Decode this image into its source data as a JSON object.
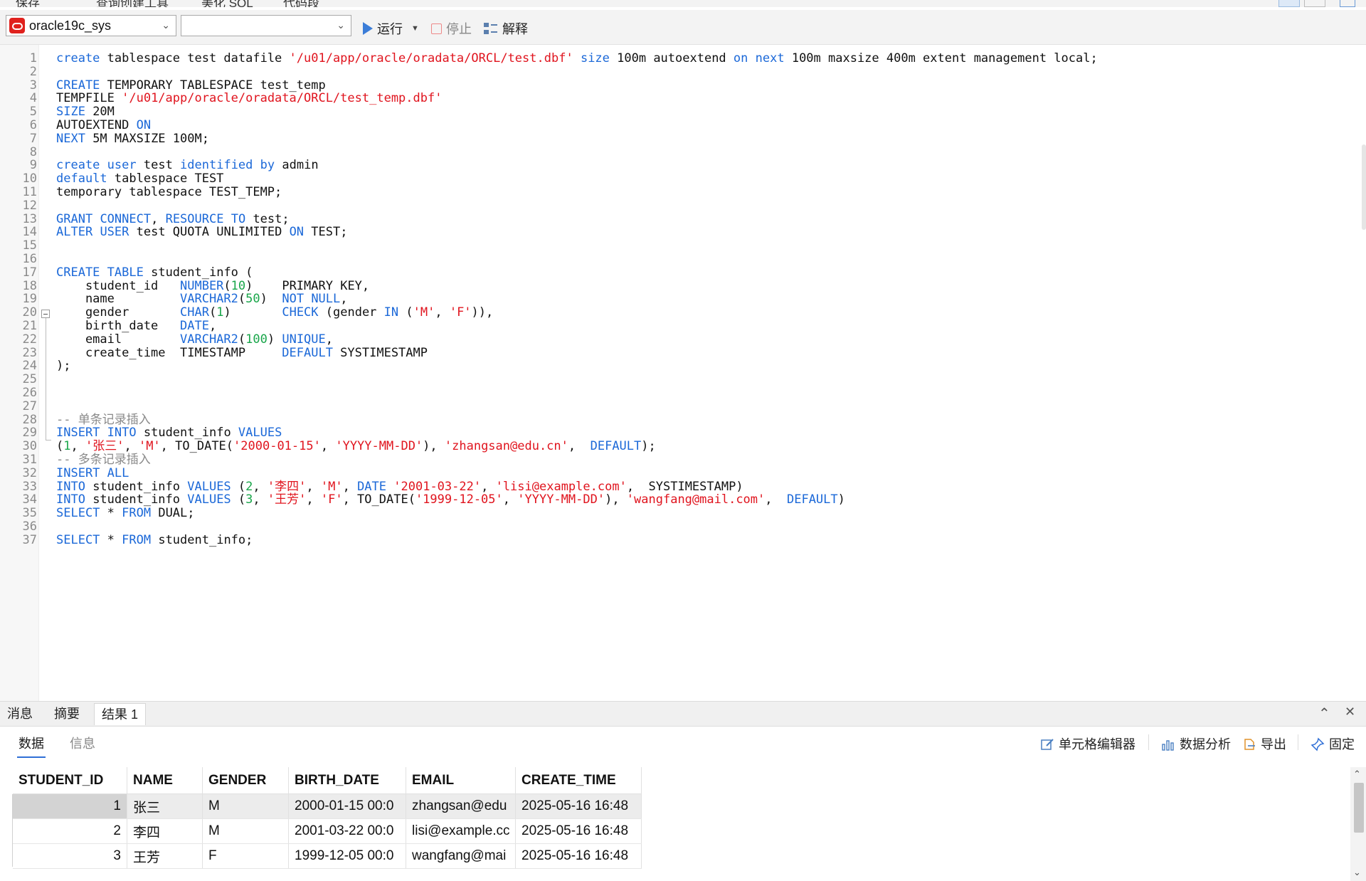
{
  "top_strip": {
    "partial_items": [
      "保存",
      "查询创建工具",
      "美化 SQL",
      "代码段"
    ]
  },
  "toolbar": {
    "connection": "oracle19c_sys",
    "database": "",
    "run_label": "运行",
    "stop_label": "停止",
    "explain_label": "解释"
  },
  "editor": {
    "lines": [
      {
        "n": "1",
        "segs": [
          [
            "kw",
            "create"
          ],
          [
            "t",
            " tablespace test datafile "
          ],
          [
            "str",
            "'/u01/app/oracle/oradata/ORCL/test.dbf'"
          ],
          [
            "t",
            " "
          ],
          [
            "kw",
            "size"
          ],
          [
            "t",
            " 100m autoextend "
          ],
          [
            "kw",
            "on"
          ],
          [
            "t",
            " "
          ],
          [
            "kw",
            "next"
          ],
          [
            "t",
            " 100m maxsize 400m extent management local;"
          ]
        ]
      },
      {
        "n": "2",
        "segs": []
      },
      {
        "n": "3",
        "segs": [
          [
            "kw",
            "CREATE"
          ],
          [
            "t",
            " TEMPORARY TABLESPACE test_temp"
          ]
        ]
      },
      {
        "n": "4",
        "segs": [
          [
            "t",
            "TEMPFILE "
          ],
          [
            "str",
            "'/u01/app/oracle/oradata/ORCL/test_temp.dbf'"
          ]
        ]
      },
      {
        "n": "5",
        "segs": [
          [
            "kw",
            "SIZE"
          ],
          [
            "t",
            " 20M"
          ]
        ]
      },
      {
        "n": "6",
        "segs": [
          [
            "t",
            "AUTOEXTEND "
          ],
          [
            "kw",
            "ON"
          ]
        ]
      },
      {
        "n": "7",
        "segs": [
          [
            "kw",
            "NEXT"
          ],
          [
            "t",
            " 5M MAXSIZE 100M;"
          ]
        ]
      },
      {
        "n": "8",
        "segs": []
      },
      {
        "n": "9",
        "segs": [
          [
            "kw",
            "create"
          ],
          [
            "t",
            " "
          ],
          [
            "kw",
            "user"
          ],
          [
            "t",
            " test "
          ],
          [
            "kw",
            "identified"
          ],
          [
            "t",
            " "
          ],
          [
            "kw",
            "by"
          ],
          [
            "t",
            " admin"
          ]
        ]
      },
      {
        "n": "10",
        "segs": [
          [
            "kw",
            "default"
          ],
          [
            "t",
            " tablespace TEST"
          ]
        ]
      },
      {
        "n": "11",
        "segs": [
          [
            "t",
            "temporary tablespace TEST_TEMP;"
          ]
        ]
      },
      {
        "n": "12",
        "segs": []
      },
      {
        "n": "13",
        "segs": [
          [
            "kw",
            "GRANT"
          ],
          [
            "t",
            " "
          ],
          [
            "kw",
            "CONNECT"
          ],
          [
            "t",
            ", "
          ],
          [
            "kw",
            "RESOURCE"
          ],
          [
            "t",
            " "
          ],
          [
            "kw",
            "TO"
          ],
          [
            "t",
            " test;"
          ]
        ]
      },
      {
        "n": "14",
        "segs": [
          [
            "kw",
            "ALTER"
          ],
          [
            "t",
            " "
          ],
          [
            "kw",
            "USER"
          ],
          [
            "t",
            " test QUOTA UNLIMITED "
          ],
          [
            "kw",
            "ON"
          ],
          [
            "t",
            " TEST;"
          ]
        ]
      },
      {
        "n": "15",
        "segs": []
      },
      {
        "n": "16",
        "segs": []
      },
      {
        "n": "17",
        "segs": [
          [
            "kw",
            "CREATE"
          ],
          [
            "t",
            " "
          ],
          [
            "kw",
            "TABLE"
          ],
          [
            "t",
            " student_info ("
          ]
        ]
      },
      {
        "n": "18",
        "segs": [
          [
            "t",
            "    student_id   "
          ],
          [
            "kw",
            "NUMBER"
          ],
          [
            "t",
            "("
          ],
          [
            "num",
            "10"
          ],
          [
            "t",
            ")    PRIMARY KEY,"
          ]
        ]
      },
      {
        "n": "19",
        "segs": [
          [
            "t",
            "    name         "
          ],
          [
            "kw",
            "VARCHAR2"
          ],
          [
            "t",
            "("
          ],
          [
            "num",
            "50"
          ],
          [
            "t",
            ")  "
          ],
          [
            "kw",
            "NOT"
          ],
          [
            "t",
            " "
          ],
          [
            "kw",
            "NULL"
          ],
          [
            "t",
            ","
          ]
        ]
      },
      {
        "n": "20",
        "segs": [
          [
            "t",
            "    gender       "
          ],
          [
            "kw",
            "CHAR"
          ],
          [
            "t",
            "("
          ],
          [
            "num",
            "1"
          ],
          [
            "t",
            ")       "
          ],
          [
            "kw",
            "CHECK"
          ],
          [
            "t",
            " (gender "
          ],
          [
            "kw",
            "IN"
          ],
          [
            "t",
            " ("
          ],
          [
            "str",
            "'M'"
          ],
          [
            "t",
            ", "
          ],
          [
            "str",
            "'F'"
          ],
          [
            "t",
            ")),"
          ]
        ]
      },
      {
        "n": "21",
        "segs": [
          [
            "t",
            "    birth_date   "
          ],
          [
            "kw",
            "DATE"
          ],
          [
            "t",
            ","
          ]
        ]
      },
      {
        "n": "22",
        "segs": [
          [
            "t",
            "    email        "
          ],
          [
            "kw",
            "VARCHAR2"
          ],
          [
            "t",
            "("
          ],
          [
            "num",
            "100"
          ],
          [
            "t",
            ") "
          ],
          [
            "kw",
            "UNIQUE"
          ],
          [
            "t",
            ","
          ]
        ]
      },
      {
        "n": "23",
        "segs": [
          [
            "t",
            "    create_time  TIMESTAMP     "
          ],
          [
            "kw",
            "DEFAULT"
          ],
          [
            "t",
            " SYSTIMESTAMP"
          ]
        ]
      },
      {
        "n": "24",
        "segs": [
          [
            "t",
            ");"
          ]
        ]
      },
      {
        "n": "25",
        "segs": []
      },
      {
        "n": "26",
        "segs": []
      },
      {
        "n": "27",
        "segs": []
      },
      {
        "n": "28",
        "segs": [
          [
            "cm",
            "-- 单条记录插入"
          ]
        ]
      },
      {
        "n": "29",
        "segs": [
          [
            "kw",
            "INSERT"
          ],
          [
            "t",
            " "
          ],
          [
            "kw",
            "INTO"
          ],
          [
            "t",
            " student_info "
          ],
          [
            "kw",
            "VALUES"
          ]
        ]
      },
      {
        "n": "30",
        "segs": [
          [
            "t",
            "("
          ],
          [
            "num",
            "1"
          ],
          [
            "t",
            ", "
          ],
          [
            "str",
            "'张三'"
          ],
          [
            "t",
            ", "
          ],
          [
            "str",
            "'M'"
          ],
          [
            "t",
            ", TO_DATE("
          ],
          [
            "str",
            "'2000-01-15'"
          ],
          [
            "t",
            ", "
          ],
          [
            "str",
            "'YYYY-MM-DD'"
          ],
          [
            "t",
            "), "
          ],
          [
            "str",
            "'zhangsan@edu.cn'"
          ],
          [
            "t",
            ",  "
          ],
          [
            "kw",
            "DEFAULT"
          ],
          [
            "t",
            ");"
          ]
        ]
      },
      {
        "n": "31",
        "segs": [
          [
            "cm",
            "-- 多条记录插入"
          ]
        ]
      },
      {
        "n": "32",
        "segs": [
          [
            "kw",
            "INSERT"
          ],
          [
            "t",
            " "
          ],
          [
            "kw",
            "ALL"
          ]
        ]
      },
      {
        "n": "33",
        "segs": [
          [
            "kw",
            "INTO"
          ],
          [
            "t",
            " student_info "
          ],
          [
            "kw",
            "VALUES"
          ],
          [
            "t",
            " ("
          ],
          [
            "num",
            "2"
          ],
          [
            "t",
            ", "
          ],
          [
            "str",
            "'李四'"
          ],
          [
            "t",
            ", "
          ],
          [
            "str",
            "'M'"
          ],
          [
            "t",
            ", "
          ],
          [
            "kw",
            "DATE"
          ],
          [
            "t",
            " "
          ],
          [
            "str",
            "'2001-03-22'"
          ],
          [
            "t",
            ", "
          ],
          [
            "str",
            "'lisi@example.com'"
          ],
          [
            "t",
            ",  SYSTIMESTAMP)"
          ]
        ]
      },
      {
        "n": "34",
        "segs": [
          [
            "kw",
            "INTO"
          ],
          [
            "t",
            " student_info "
          ],
          [
            "kw",
            "VALUES"
          ],
          [
            "t",
            " ("
          ],
          [
            "num",
            "3"
          ],
          [
            "t",
            ", "
          ],
          [
            "str",
            "'王芳'"
          ],
          [
            "t",
            ", "
          ],
          [
            "str",
            "'F'"
          ],
          [
            "t",
            ", TO_DATE("
          ],
          [
            "str",
            "'1999-12-05'"
          ],
          [
            "t",
            ", "
          ],
          [
            "str",
            "'YYYY-MM-DD'"
          ],
          [
            "t",
            "), "
          ],
          [
            "str",
            "'wangfang@mail.com'"
          ],
          [
            "t",
            ",  "
          ],
          [
            "kw",
            "DEFAULT"
          ],
          [
            "t",
            ")"
          ]
        ]
      },
      {
        "n": "35",
        "segs": [
          [
            "kw",
            "SELECT"
          ],
          [
            "t",
            " * "
          ],
          [
            "kw",
            "FROM"
          ],
          [
            "t",
            " DUAL;"
          ]
        ]
      },
      {
        "n": "36",
        "segs": []
      },
      {
        "n": "37",
        "segs": [
          [
            "kw",
            "SELECT"
          ],
          [
            "t",
            " * "
          ],
          [
            "kw",
            "FROM"
          ],
          [
            "t",
            " student_info;"
          ]
        ]
      }
    ]
  },
  "panel": {
    "tabs": [
      "消息",
      "摘要",
      "结果 1"
    ],
    "active_tab": "结果 1",
    "subtabs": [
      "数据",
      "信息"
    ],
    "tools": {
      "cell_editor": "单元格编辑器",
      "data_analysis": "数据分析",
      "export": "导出",
      "pin": "固定"
    },
    "grid": {
      "columns": [
        "STUDENT_ID",
        "NAME",
        "GENDER",
        "BIRTH_DATE",
        "EMAIL",
        "CREATE_TIME"
      ],
      "rows": [
        [
          "1",
          "张三",
          "M",
          "2000-01-15 00:0",
          "zhangsan@edu",
          "2025-05-16 16:48"
        ],
        [
          "2",
          "李四",
          "M",
          "2001-03-22 00:0",
          "lisi@example.cc",
          "2025-05-16 16:48"
        ],
        [
          "3",
          "王芳",
          "F",
          "1999-12-05 00:0",
          "wangfang@mai",
          "2025-05-16 16:48"
        ]
      ]
    }
  },
  "colors": {
    "keyword": "#1b68d8",
    "string": "#e0141e",
    "number": "#19a64a",
    "comment": "#8a8a8a",
    "accent": "#2f6fd6"
  }
}
